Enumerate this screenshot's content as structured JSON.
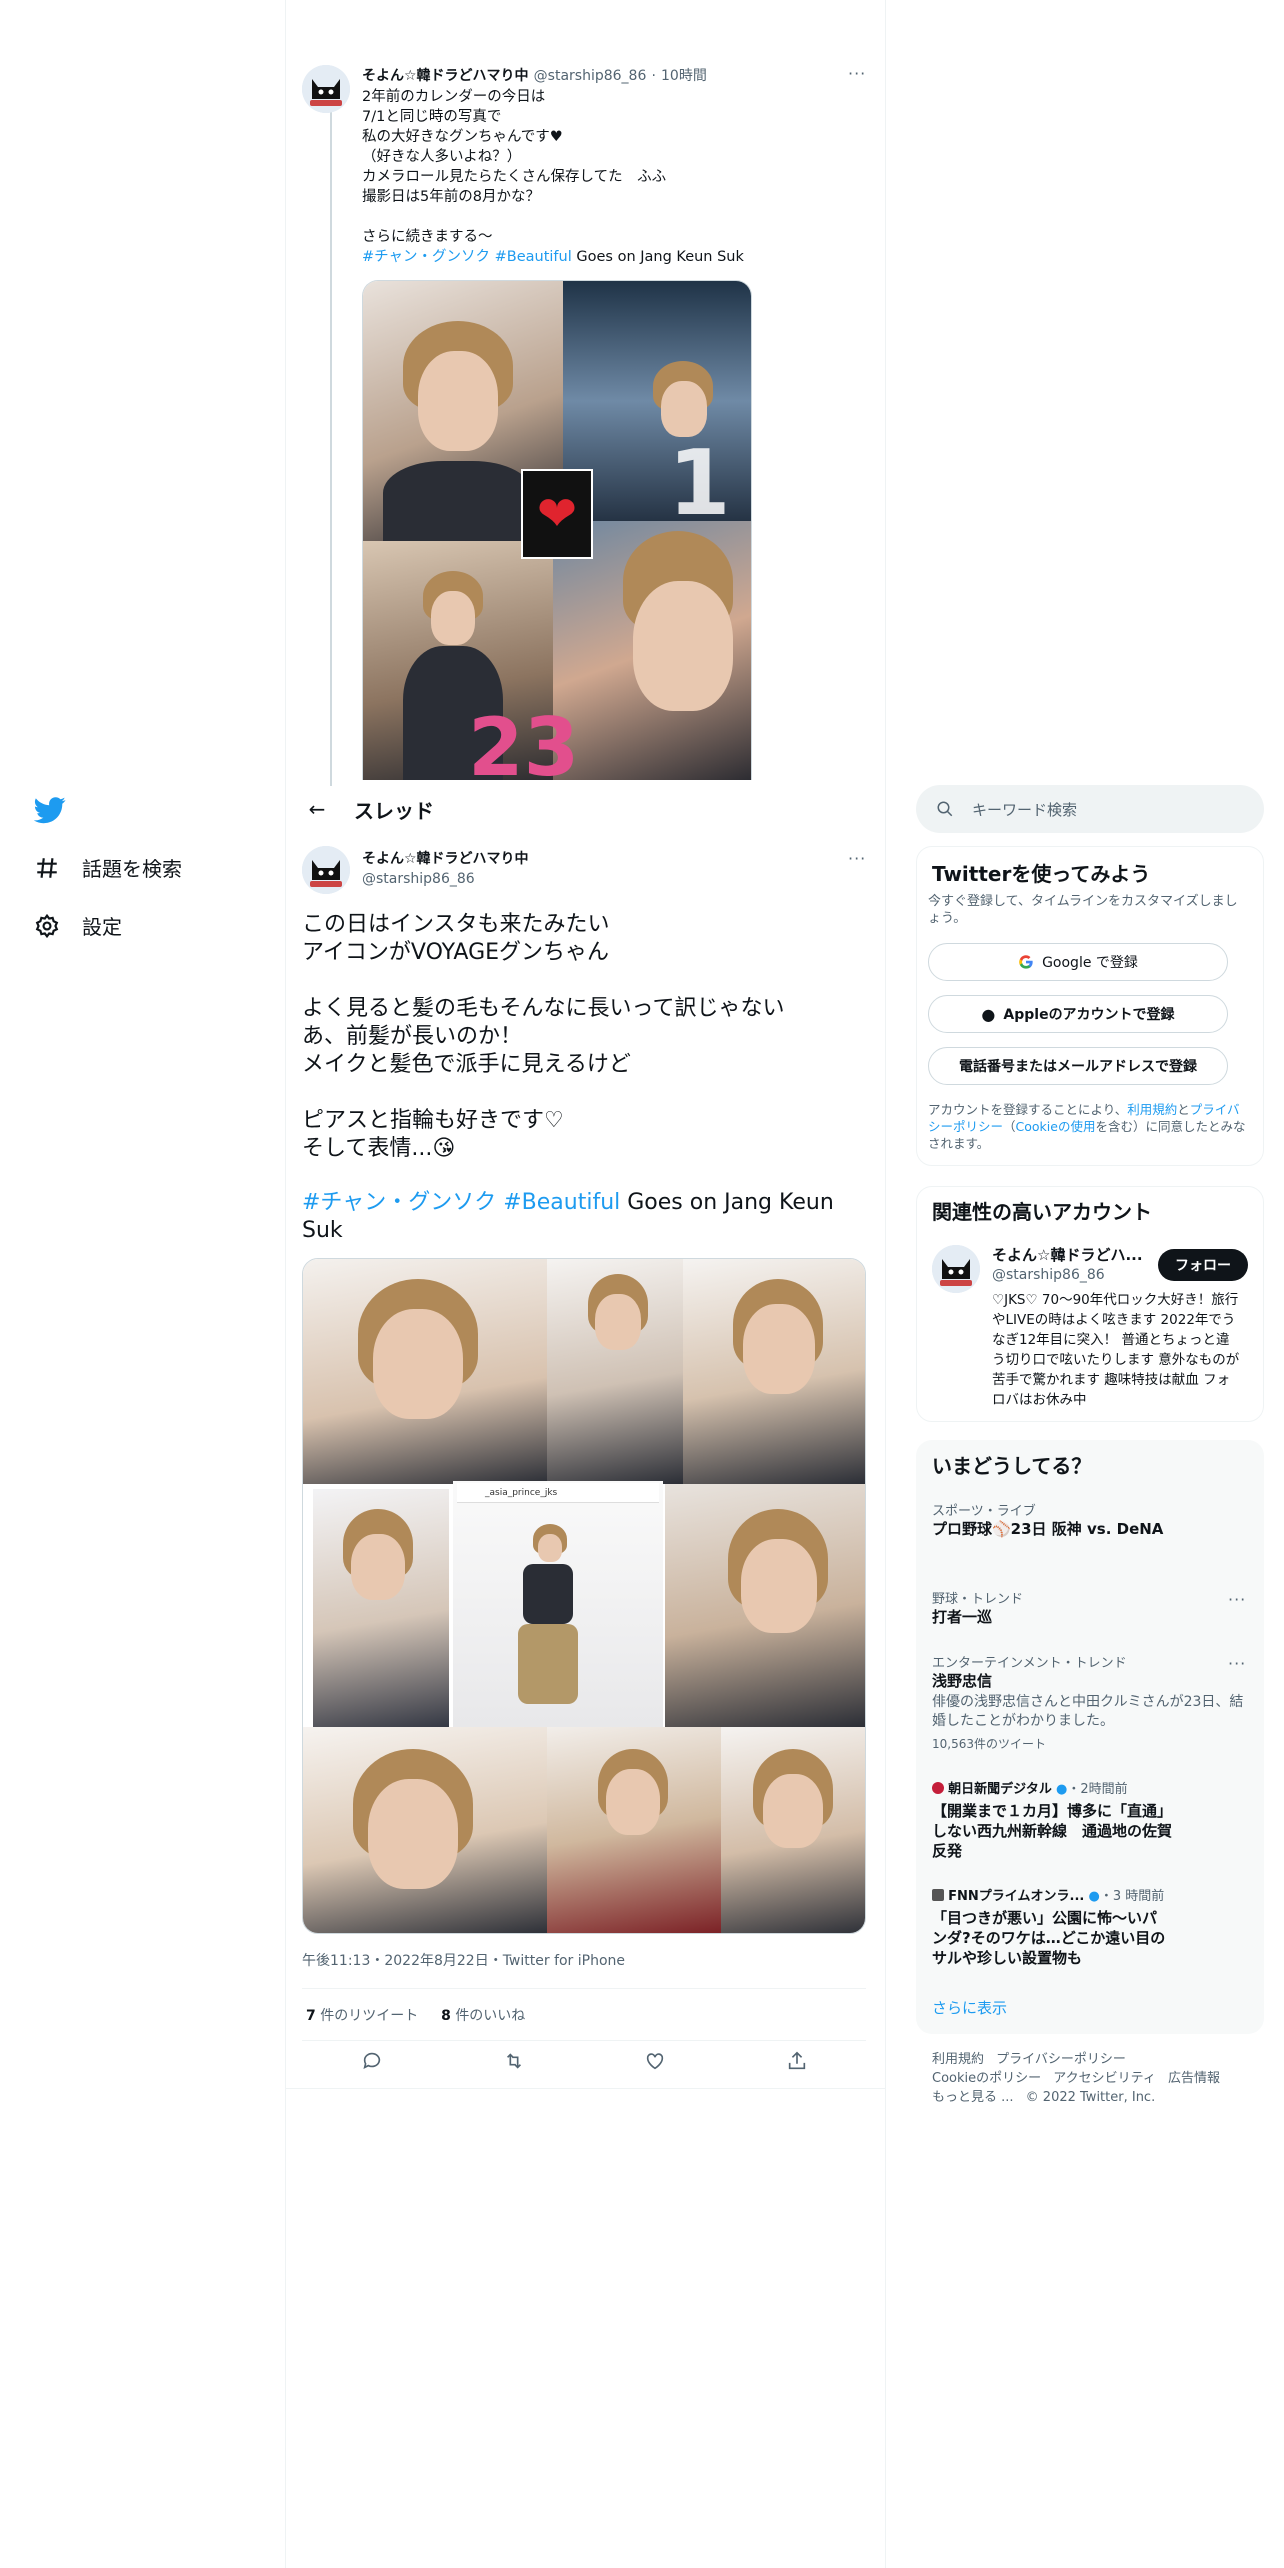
{
  "nav": {
    "explore": "話題を検索",
    "settings": "設定"
  },
  "prev_tweet": {
    "name": "そよん☆韓ドラどハマり中",
    "handle": "@starship86_86",
    "time": "10時間",
    "text": "2年前のカレンダーの今日は\n7/1と同じ時の写真で\n私の大好きなグンちゃんです♥\n（好きな人多いよね？）\nカメラロール見たらたくさん保存してた　ふふ\n撮影日は5年前の8月かな？\n\nさらに続きまする〜",
    "hashtag1": "#チャン・グンソク",
    "hashtag2": "#Beautiful",
    "tail": "Goes on Jang Keun Suk",
    "image_numbers": [
      "1",
      "23"
    ]
  },
  "thread": {
    "back": "←",
    "title": "スレッド"
  },
  "tweet": {
    "name": "そよん☆韓ドラどハマり中",
    "handle": "@starship86_86",
    "text": "この日はインスタも来たみたい\nアイコンがVOYAGEグンちゃん\n\nよく見ると髪の毛もそんなに長いって訳じゃない\nあ、前髪が長いのか！\nメイクと髪色で派手に見えるけど\n\nピアスと指輪も好きです♡\nそして表情...😘",
    "hashtag1": "#チャン・グンソク",
    "hashtag2": "#Beautiful",
    "tail": "Goes on Jang Keun Suk",
    "insta_handle": "_asia_prince_jks",
    "meta": "午後11:13・2022年8月22日・Twitter for iPhone",
    "retweets_count": "7",
    "retweets_label": "件のリツイート",
    "likes_count": "8",
    "likes_label": "件のいいね"
  },
  "search": {
    "placeholder": "キーワード検索"
  },
  "signup": {
    "title": "Twitterを使ってみよう",
    "subtitle": "今すぐ登録して、タイムラインをカスタマイズしましょう。",
    "google": "Google で登録",
    "apple": "Appleのアカウントで登録",
    "phone": "電話番号またはメールアドレスで登録",
    "legal_1": "アカウントを登録することにより、",
    "legal_terms": "利用規約",
    "legal_2": "と",
    "legal_privacy": "プライバシーポリシー",
    "legal_3": "（",
    "legal_cookie": "Cookieの使用",
    "legal_4": "を含む）に同意したとみなされます。"
  },
  "related": {
    "title": "関連性の高いアカウント",
    "name": "そよん☆韓ドラどハ...",
    "handle": "@starship86_86",
    "follow": "フォロー",
    "bio": "♡JKS♡ 70〜90年代ロック大好き！旅行やLIVEの時はよく呟きます 2022年でうなぎ12年目に突入！ 普通とちょっと違う切り口で呟いたりします 意外なものが苦手で驚かれます 趣味特技は献血 フォロバはお休み中"
  },
  "trends": {
    "title": "いまどうしてる？",
    "items": [
      {
        "meta": "スポーツ・ライブ",
        "title": "プロ野球⚾23日 阪神 vs. DeNA"
      },
      {
        "meta": "野球・トレンド",
        "title": "打者一巡"
      },
      {
        "meta": "エンターテインメント・トレンド",
        "title": "浅野忠信",
        "desc": "俳優の浅野忠信さんと中田クルミさんが23日、結婚したことがわかりました。",
        "count": "10,563件のツイート"
      },
      {
        "source": "朝日新聞デジタル",
        "time": "・2時間前",
        "title": "【開業まで１カ月】博多に「直通」しない西九州新幹線　通過地の佐賀反発"
      },
      {
        "source": "FNNプライムオンラ...",
        "time": "・3 時間前",
        "title": "「目つきが悪い」公園に怖～いパンダ?そのワケは…どこか遠い目のサルや珍しい設置物も"
      }
    ],
    "more": "さらに表示"
  },
  "footer": {
    "terms": "利用規約",
    "privacy": "プライバシーポリシー",
    "cookie": "Cookieのポリシー",
    "accessibility": "アクセシビリティ",
    "ads": "広告情報",
    "more": "もっと見る ...",
    "copyright": "© 2022 Twitter, Inc."
  },
  "colors": {
    "accent": "#1d9bf0",
    "text": "#0f1419",
    "secondary": "#536471"
  }
}
